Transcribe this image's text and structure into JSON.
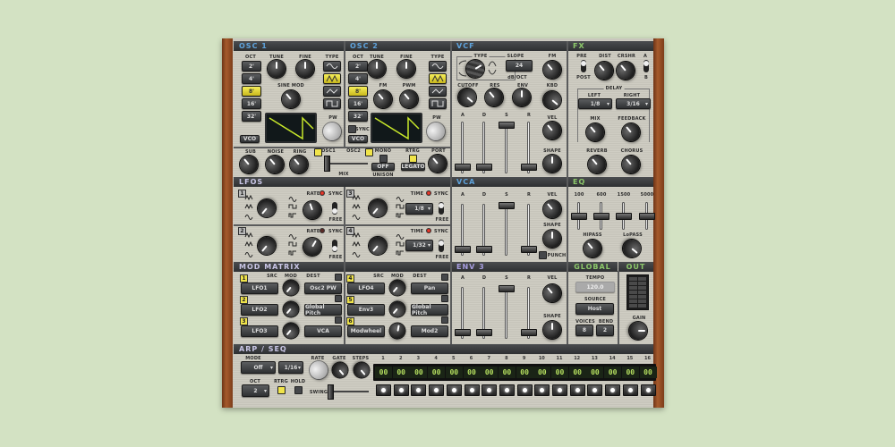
{
  "sections": {
    "osc1": "OSC 1",
    "osc2": "OSC 2",
    "vcf": "VCF",
    "fx": "FX",
    "lfos": "LFOs",
    "vca": "VCA",
    "eq": "EQ",
    "mod_matrix": "MOD MATRIX",
    "env3": "ENV 3",
    "global": "GLOBAL",
    "out": "OUT",
    "arp": "ARP / SEQ"
  },
  "osc1": {
    "oct": "OCT",
    "tune": "TUNE",
    "fine": "FINE",
    "type": "TYPE",
    "sine_mod": "SINE MOD",
    "pw": "PW",
    "vco": "VCO",
    "octaves": [
      "2'",
      "4'",
      "8'",
      "16'",
      "32'"
    ],
    "selected_octave": "8'"
  },
  "osc2": {
    "oct": "OCT",
    "tune": "TUNE",
    "fine": "FINE",
    "type": "TYPE",
    "fm": "FM",
    "pwm": "PWM",
    "pw": "PW",
    "sync": "SYNC",
    "vco": "VCO",
    "octaves": [
      "2'",
      "4'",
      "8'",
      "16'",
      "32'"
    ],
    "selected_octave": "8'"
  },
  "mixer": {
    "sub": "SUB",
    "noise": "NOISE",
    "ring": "RING",
    "osc1": "OSC1",
    "osc2": "OSC2",
    "mix": "MIX",
    "mono": "MONO",
    "rtrg": "RTRG",
    "unison_value": "OFF",
    "unison": "UNISON",
    "legato": "LEGATO",
    "port": "PORT"
  },
  "vcf": {
    "type": "TYPE",
    "slope": "SLOPE",
    "slope_value": "24",
    "db_oct": "dB/OCT",
    "fm": "FM",
    "cutoff": "CUTOFF",
    "res": "RES",
    "env": "ENV",
    "kbd": "KBD",
    "a": "A",
    "d": "D",
    "s": "S",
    "r": "R",
    "vel": "VEL",
    "shape": "SHAPE"
  },
  "fx": {
    "pre": "PRE",
    "post": "POST",
    "dist": "DIST",
    "crshr": "CRSHR",
    "a": "A",
    "b": "B",
    "delay": "DELAY",
    "left": "LEFT",
    "left_value": "1/8",
    "right": "RIGHT",
    "right_value": "3/16",
    "mix": "MIX",
    "feedback": "FEEDBACK",
    "reverb": "REVERB",
    "chorus": "CHORUS"
  },
  "lfos": [
    {
      "num": "1",
      "rate": "RATE",
      "sync": "SYNC",
      "free": "FREE"
    },
    {
      "num": "2",
      "rate": "RATE",
      "sync": "SYNC",
      "free": "FREE"
    },
    {
      "num": "3",
      "time": "TIME",
      "sync": "SYNC",
      "free": "FREE",
      "time_value": "1/8"
    },
    {
      "num": "4",
      "time": "TIME",
      "sync": "SYNC",
      "free": "FREE",
      "time_value": "1/32"
    }
  ],
  "vca": {
    "a": "A",
    "d": "D",
    "s": "S",
    "r": "R",
    "vel": "VEL",
    "shape": "SHAPE",
    "punch": "PUNCH"
  },
  "eq": {
    "bands": [
      "100",
      "600",
      "1500",
      "5000"
    ],
    "hipass": "HIPASS",
    "lopass": "LoPASS"
  },
  "mod_matrix": {
    "src": "SRC",
    "mod": "MOD",
    "dest": "DEST",
    "slots": [
      {
        "num": "1",
        "src": "LFO1",
        "dest": "Osc2 PW"
      },
      {
        "num": "2",
        "src": "LFO2",
        "dest": "Global Pitch"
      },
      {
        "num": "3",
        "src": "LFO3",
        "dest": "VCA"
      },
      {
        "num": "4",
        "src": "LFO4",
        "dest": "Pan"
      },
      {
        "num": "5",
        "src": "Env3",
        "dest": "Global Pitch"
      },
      {
        "num": "6",
        "src": "Modwheel",
        "dest": "Mod2"
      }
    ]
  },
  "env3": {
    "a": "A",
    "d": "D",
    "s": "S",
    "r": "R",
    "vel": "VEL",
    "shape": "SHAPE"
  },
  "global": {
    "tempo": "TEMPO",
    "tempo_value": "120.0",
    "source": "SOURCE",
    "source_value": "Host",
    "voices": "VOICES",
    "voices_value": "8",
    "bend": "BEND",
    "bend_value": "2"
  },
  "out": {
    "gain": "GAIN"
  },
  "arp": {
    "mode": "MODE",
    "mode_value": "Off",
    "rate_value": "1/16",
    "rate": "RATE",
    "gate": "GATE",
    "steps": "STEPS",
    "oct": "OCT",
    "oct_value": "2",
    "rtrg": "RTRG",
    "hold": "HOLD",
    "swing": "SWING",
    "step_numbers": [
      "1",
      "2",
      "3",
      "4",
      "5",
      "6",
      "7",
      "8",
      "9",
      "10",
      "11",
      "12",
      "13",
      "14",
      "15",
      "16"
    ],
    "step_values": [
      "00",
      "00",
      "00",
      "00",
      "00",
      "00",
      "00",
      "00",
      "00",
      "00",
      "00",
      "00",
      "00",
      "00",
      "00",
      "00"
    ]
  },
  "colors": {
    "background": "#d3e2c3",
    "active": "#f0e44a",
    "header_blue": "#5ea3dc",
    "header_green": "#8cc86a",
    "scope_trace": "#c8e82a"
  }
}
